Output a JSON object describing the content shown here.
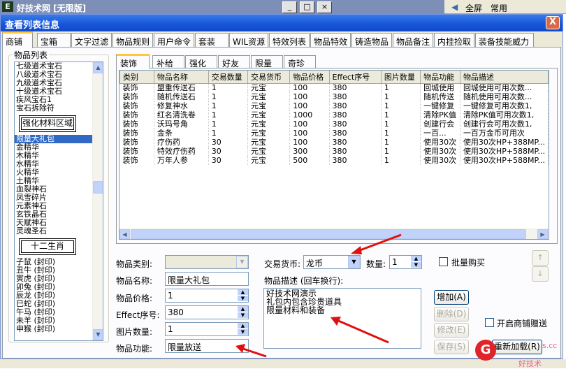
{
  "bg": {
    "app_title": "好技术网 [无限版]",
    "right_items": [
      "全屏",
      "常用"
    ]
  },
  "dialog": {
    "title": "查看列表信息",
    "close": "X"
  },
  "tabs": [
    "商铺",
    "宝箱",
    "文字过滤",
    "物品规则",
    "用户命令",
    "套装",
    "WIL资源",
    "特效列表",
    "物品特效",
    "铸造物品",
    "物品备注",
    "内挂捡取",
    "装备技能威力"
  ],
  "item_list": {
    "caption": "物品列表",
    "items": [
      {
        "t": "七级道术宝石"
      },
      {
        "t": "八级道术宝石"
      },
      {
        "t": "九级道术宝石"
      },
      {
        "t": "十级道术宝石"
      },
      {
        "t": "疾风宝石1"
      },
      {
        "t": "宝石拆除符"
      },
      {
        "t": "强化材料区域",
        "box": true
      },
      {
        "t": "限量大礼包",
        "sel": true
      },
      {
        "t": "金精华"
      },
      {
        "t": "木精华"
      },
      {
        "t": "水精华"
      },
      {
        "t": "火精华"
      },
      {
        "t": "土精华"
      },
      {
        "t": "血裂神石"
      },
      {
        "t": "凤雪碎片"
      },
      {
        "t": "元素神石"
      },
      {
        "t": "玄铁晶石"
      },
      {
        "t": "天赋神石"
      },
      {
        "t": "灵魂圣石"
      },
      {
        "t": "十二生肖",
        "box": true
      },
      {
        "t": "子鼠 (封印)"
      },
      {
        "t": "丑牛 (封印)"
      },
      {
        "t": "寅虎 (封印)"
      },
      {
        "t": "卯兔 (封印)"
      },
      {
        "t": "辰龙 (封印)"
      },
      {
        "t": "巳蛇 (封印)"
      },
      {
        "t": "午马 (封印)"
      },
      {
        "t": "未羊 (封印)"
      },
      {
        "t": "申猴 (封印)"
      }
    ]
  },
  "subtabs": [
    "装饰",
    "补给",
    "强化",
    "好友",
    "限量",
    "奇珍"
  ],
  "grid": {
    "columns": [
      "类别",
      "物品名称",
      "交易数量",
      "交易货币",
      "物品价格",
      "Effect序号",
      "图片数量",
      "物品功能",
      "物品描述"
    ],
    "rows": [
      [
        "装饰",
        "盟重传送石",
        "1",
        "元宝",
        "100",
        "380",
        "1",
        "回城使用",
        "回城使用可用次数..."
      ],
      [
        "装饰",
        "随机传送石",
        "1",
        "元宝",
        "100",
        "380",
        "1",
        "随机传送",
        "随机使用可用次数..."
      ],
      [
        "装饰",
        "修复神水",
        "1",
        "元宝",
        "100",
        "380",
        "1",
        "一键修复",
        "一键修复可用次数1,"
      ],
      [
        "装饰",
        "红名清洗卷",
        "1",
        "元宝",
        "1000",
        "380",
        "1",
        "清除PK值",
        "清除PK值可用次数1,"
      ],
      [
        "装饰",
        "沃玛号角",
        "1",
        "元宝",
        "100",
        "380",
        "1",
        "创建行会",
        "创建行会可用次数1,"
      ],
      [
        "装饰",
        "金条",
        "1",
        "元宝",
        "100",
        "380",
        "1",
        "一百...",
        "一百万金币可用次"
      ],
      [
        "装饰",
        "疗伤药",
        "30",
        "元宝",
        "100",
        "380",
        "1",
        "使用30次",
        "使用30次HP+388MP..."
      ],
      [
        "装饰",
        "特效疗伤药",
        "30",
        "元宝",
        "300",
        "380",
        "1",
        "使用30次",
        "使用30次HP+588MP..."
      ],
      [
        "装饰",
        "万年人参",
        "30",
        "元宝",
        "500",
        "380",
        "1",
        "使用30次",
        "使用30次HP+588MP..."
      ]
    ]
  },
  "form": {
    "category_label": "物品类别:",
    "category_value": "",
    "name_label": "物品名称:",
    "name_value": "限量大礼包",
    "price_label": "物品价格:",
    "price_value": "1",
    "effect_label": "Effect序号:",
    "effect_value": "380",
    "pic_label": "图片数量:",
    "pic_value": "1",
    "func_label": "物品功能:",
    "func_value": "限量放送",
    "currency_label": "交易货币:",
    "currency_value": "龙币",
    "qty_label": "数量:",
    "qty_value": "1",
    "bulk_label": "批量购买",
    "desc_label": "物品描述 (回车换行):",
    "desc_lines": [
      "好技术网演示",
      "礼包内包含珍贵道具",
      "限量材料和装备"
    ],
    "shop_gift_label": "开启商铺赠送"
  },
  "buttons": {
    "add": "增加(A)",
    "delete": "删除(D)",
    "modify": "修改(E)",
    "save": "保存(S)",
    "reload": "重新加载(R)",
    "up": "↑",
    "down": "↓"
  },
  "watermark": {
    "text": "好技术",
    "site": "s.cc"
  }
}
